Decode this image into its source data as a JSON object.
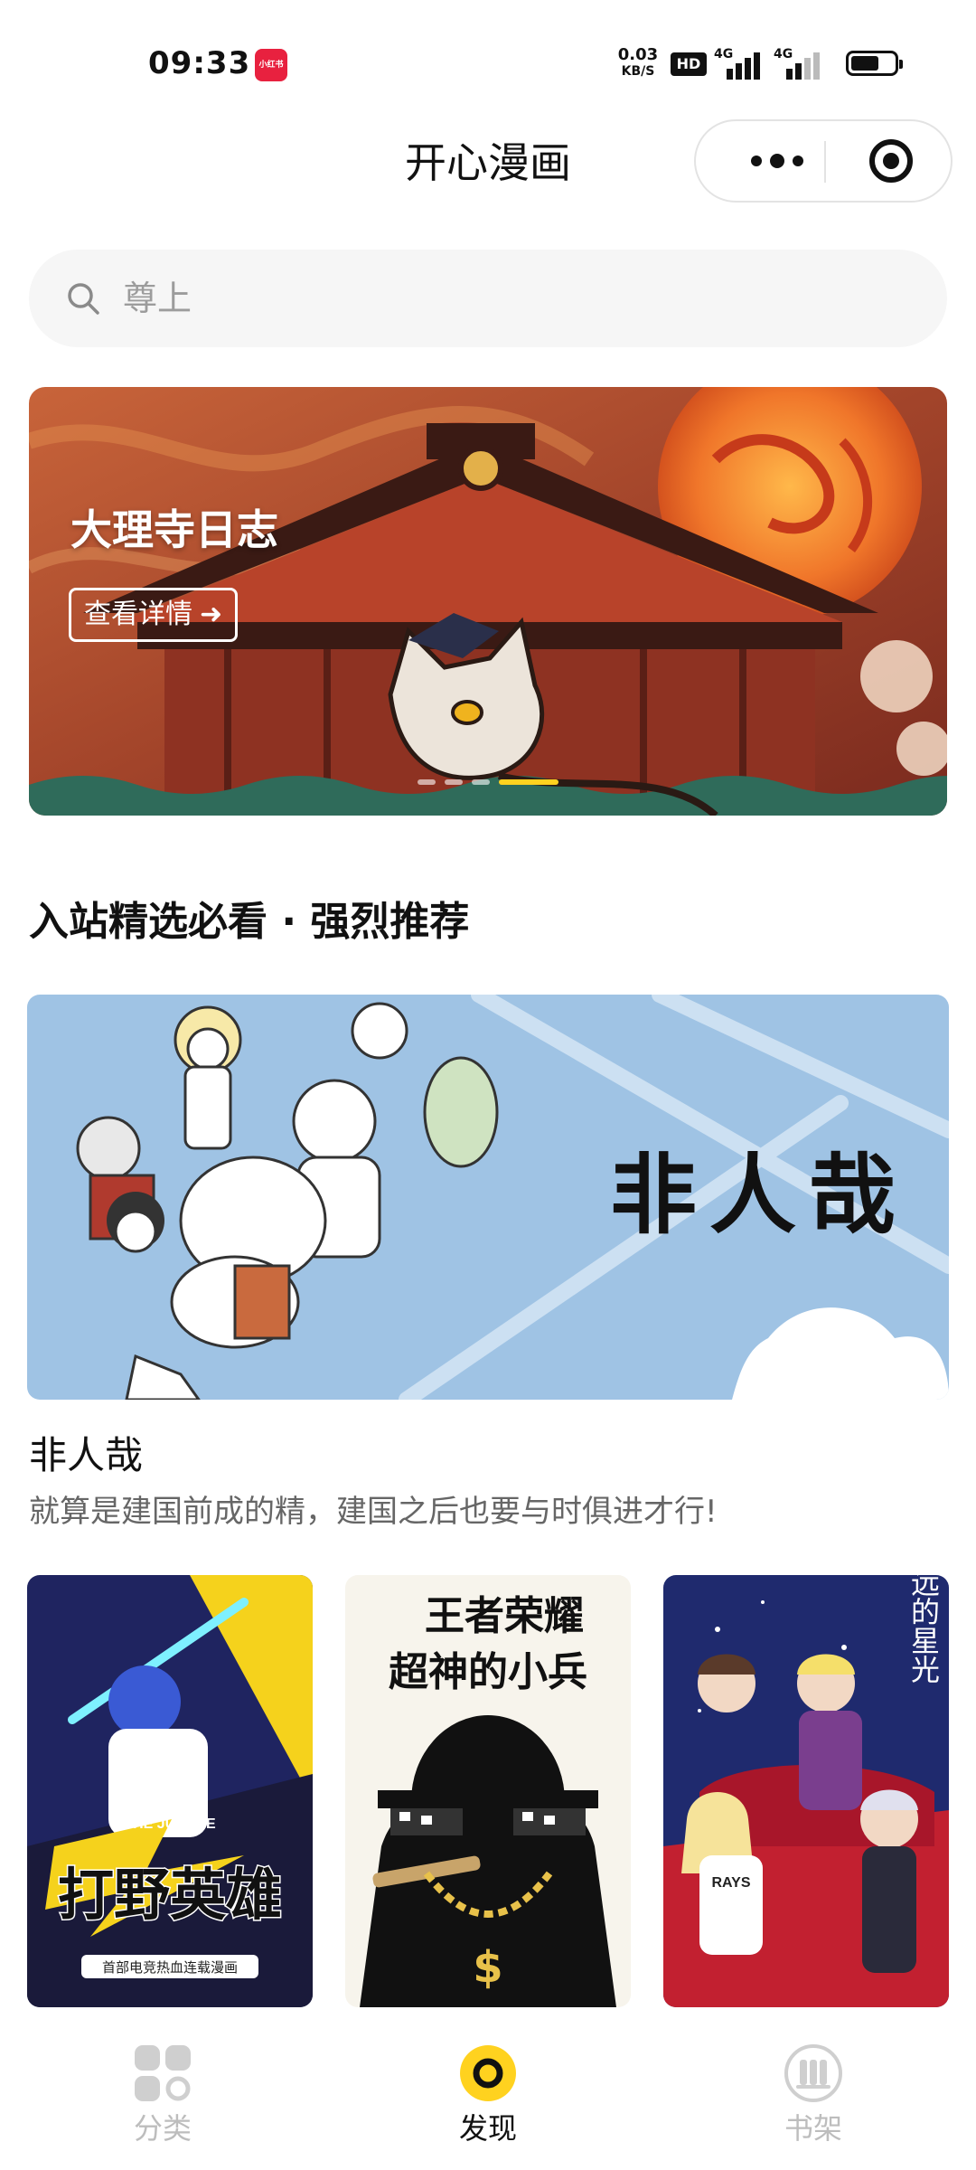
{
  "status_bar": {
    "time": "09:33",
    "app_badge": "小红书",
    "net_speed_value": "0.03",
    "net_speed_unit": "KB/S",
    "hd_label": "HD",
    "signal1_label": "4G",
    "signal2_label": "4G"
  },
  "header": {
    "title": "开心漫画"
  },
  "search": {
    "placeholder": "尊上"
  },
  "banner": {
    "title": "大理寺日志",
    "button_label": "查看详情",
    "button_arrow": "➜",
    "active_slide": 4,
    "slide_count": 4
  },
  "section": {
    "title": "入站精选必看 · 强烈推荐"
  },
  "featured": {
    "name": "非人哉",
    "description": "就算是建国前成的精，建国之后也要与时俱进才行!",
    "cover_title": "非人哉"
  },
  "covers": [
    {
      "title_en": "THE JUNGLE",
      "title": "打野英雄",
      "tagline": "首部电竞热血连载漫画"
    },
    {
      "title_line1": "王者荣耀",
      "title_line2": "超神的小兵"
    },
    {
      "title": "遥远的星光",
      "badge": "RAYS"
    }
  ],
  "tabbar": {
    "tabs": [
      {
        "label": "分类",
        "icon": "grid-icon"
      },
      {
        "label": "发现",
        "icon": "discover-icon"
      },
      {
        "label": "书架",
        "icon": "bookshelf-icon"
      }
    ],
    "active": 1
  },
  "colors": {
    "accent": "#ffd21f",
    "badge_red": "#e8213f",
    "muted_text": "#666666"
  }
}
